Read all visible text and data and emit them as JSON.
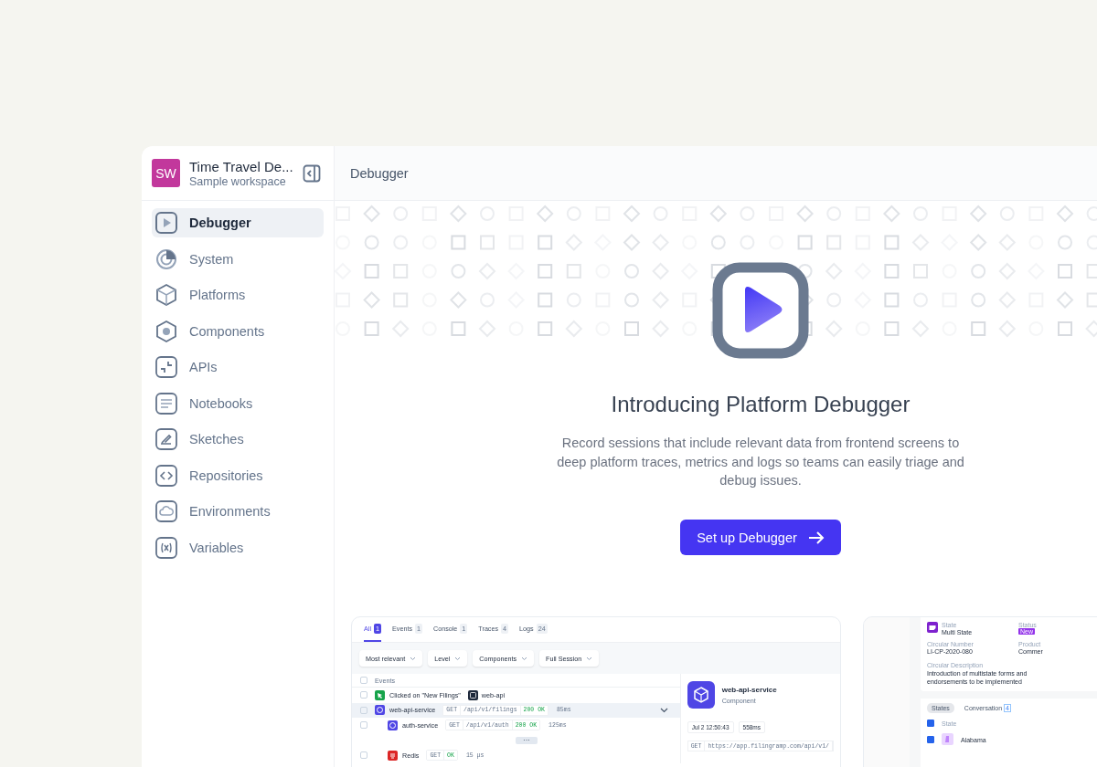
{
  "workspace": {
    "avatar": "SW",
    "name": "Time Travel De...",
    "subtitle": "Sample workspace"
  },
  "sidebar": {
    "items": [
      {
        "label": "Debugger",
        "kind": "play",
        "selected": true
      },
      {
        "label": "System",
        "kind": "radar",
        "selected": false
      },
      {
        "label": "Platforms",
        "kind": "cube",
        "selected": false
      },
      {
        "label": "Components",
        "kind": "hexagon",
        "selected": false
      },
      {
        "label": "APIs",
        "kind": "corners",
        "selected": false
      },
      {
        "label": "Notebooks",
        "kind": "lines",
        "selected": false
      },
      {
        "label": "Sketches",
        "kind": "pencil",
        "selected": false
      },
      {
        "label": "Repositories",
        "kind": "code",
        "selected": false
      },
      {
        "label": "Environments",
        "kind": "cloud",
        "selected": false
      },
      {
        "label": "Variables",
        "kind": "variable",
        "selected": false
      }
    ]
  },
  "header": {
    "title": "Debugger"
  },
  "hero": {
    "title": "Introducing Platform Debugger",
    "description": "Record sessions that include relevant data from frontend screens to deep platform traces, metrics and logs so teams can easily triage and debug issues.",
    "button": "Set up Debugger"
  },
  "preview_1": {
    "tabs": [
      {
        "label": "All",
        "count": "1",
        "selected": true
      },
      {
        "label": "Events",
        "count": "1",
        "selected": false
      },
      {
        "label": "Console",
        "count": "1",
        "selected": false
      },
      {
        "label": "Traces",
        "count": "4",
        "selected": false
      },
      {
        "label": "Logs",
        "count": "24",
        "selected": false
      }
    ],
    "filters": [
      "Most relevant",
      "Level",
      "Components",
      "Full Session"
    ],
    "events_header": "Events",
    "header_checked": false,
    "events": [
      {
        "kind": "click",
        "label": "Clicked on \"New Filings\"",
        "tag": "web-api",
        "selected": false,
        "checked": false
      },
      {
        "kind": "service",
        "label": "web-api-service",
        "method": "GET",
        "path": "/api/v1/filings",
        "status": "200 OK",
        "duration": "85ms",
        "selected": true,
        "checked": false,
        "expanded": true,
        "children": [
          {
            "kind": "service",
            "label": "auth-service",
            "method": "GET",
            "path": "/api/v1/auth",
            "status": "200 OK",
            "duration": "125ms",
            "selected": false,
            "checked": false
          },
          {
            "kind": "more",
            "label": "···",
            "selected": false
          },
          {
            "kind": "redis",
            "label": "Redis",
            "method": "GET",
            "status": "OK",
            "duration": "15 μs",
            "selected": false,
            "checked": false
          }
        ]
      }
    ],
    "detail": {
      "name": "web-api-service",
      "type": "Component",
      "time": "Jul 2 12:50:43",
      "duration": "558ms",
      "method": "GET",
      "url": "https://app.filingramp.com/api/v1/"
    }
  },
  "preview_2": {
    "fields": [
      {
        "label": "State",
        "value": "Multi State"
      },
      {
        "label": "Status",
        "badge": "New"
      },
      {
        "label": "Circular Number",
        "value": "LI-CP-2020-080"
      },
      {
        "label": "Product",
        "value": "Commer"
      }
    ],
    "description_label": "Circular Description",
    "description": "Introduction of multistate forms and endorsements to be implemented",
    "tabs": [
      {
        "label": "States",
        "selected": true
      },
      {
        "label": "Conversation",
        "count": "4",
        "selected": false
      }
    ],
    "column": "State",
    "all_checked": true,
    "rows": [
      {
        "label": "Alabama",
        "checked": true
      }
    ]
  }
}
